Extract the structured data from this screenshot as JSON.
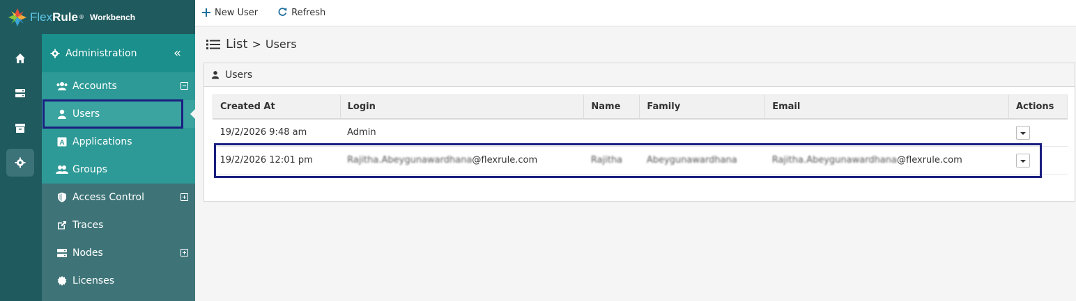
{
  "brand": {
    "flex": "Flex",
    "rule": "Rule",
    "reg": "®",
    "workbench": "Workbench"
  },
  "rail": {
    "icons": [
      "home-icon",
      "server-icon",
      "archive-icon",
      "gear-icon"
    ]
  },
  "sidebar": {
    "section_title": "Administration",
    "items": [
      {
        "label": "Accounts",
        "icon": "users-icon",
        "toggle": "minus"
      },
      {
        "label": "Users",
        "icon": "user-icon",
        "selected": true
      },
      {
        "label": "Applications",
        "icon": "app-icon"
      },
      {
        "label": "Groups",
        "icon": "group-icon"
      },
      {
        "label": "Access Control",
        "icon": "shield-icon",
        "toggle": "plus"
      },
      {
        "label": "Traces",
        "icon": "external-link-icon"
      },
      {
        "label": "Nodes",
        "icon": "server-icon",
        "toggle": "plus"
      },
      {
        "label": "Licenses",
        "icon": "certificate-icon"
      }
    ]
  },
  "toolbar": {
    "new_user": "New User",
    "refresh": "Refresh"
  },
  "breadcrumb": {
    "list": "List",
    "separator": ">",
    "current": "Users"
  },
  "panel": {
    "title": "Users"
  },
  "table": {
    "columns": [
      "Created At",
      "Login",
      "Name",
      "Family",
      "Email",
      "Actions"
    ],
    "rows": [
      {
        "created_at": "19/2/2026 9:48 am",
        "login": "Admin",
        "name": "",
        "family": "",
        "email": ""
      },
      {
        "created_at": "19/2/2026 12:01 pm",
        "login_blur": "Rajitha.Abeygunawardhana",
        "login_domain": "@flexrule.com",
        "name": "Rajitha",
        "family": "Abeygunawardhana",
        "email_blur": "Rajitha.Abeygunawardhana",
        "email_domain": "@flexrule.com"
      }
    ]
  },
  "colors": {
    "rail": "#1f5a5e",
    "admin_header": "#1a8f8b",
    "submenu": "#2e9a97",
    "sidebar": "#3e7478",
    "highlight_border": "#1a1f80",
    "toolbar_icon": "#1f6e9e"
  }
}
